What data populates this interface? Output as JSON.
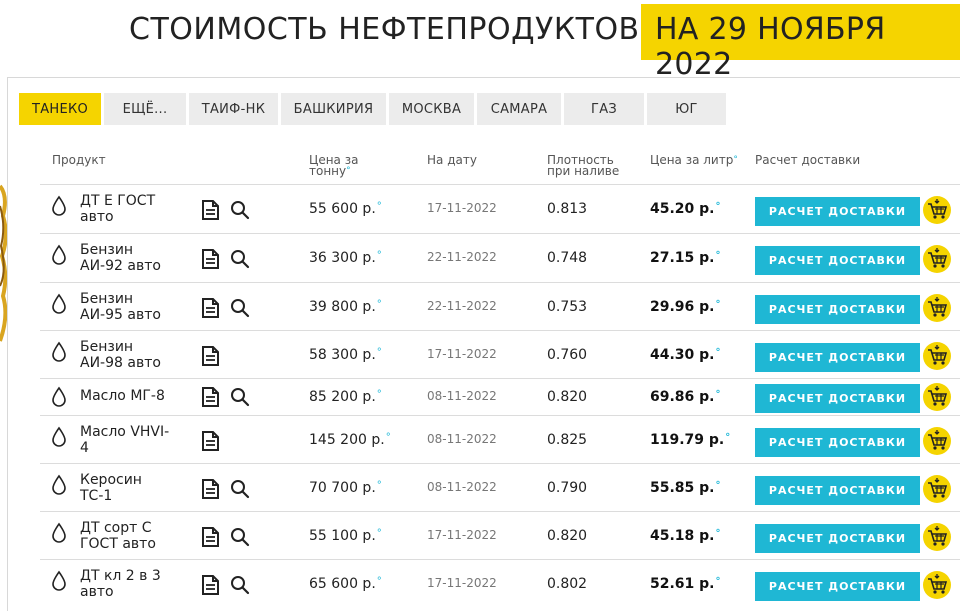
{
  "header": {
    "title": "СТОИМОСТЬ НЕФТЕПРОДУКТОВ",
    "date": "НА 29 НОЯБРЯ 2022"
  },
  "tabs": [
    {
      "label": "ТАНЕКО",
      "active": true
    },
    {
      "label": "ЕЩЁ...",
      "active": false
    },
    {
      "label": "ТАИФ-НК",
      "active": false
    },
    {
      "label": "БАШКИРИЯ",
      "active": false
    },
    {
      "label": "МОСКВА",
      "active": false
    },
    {
      "label": "САМАРА",
      "active": false
    },
    {
      "label": "ГАЗ",
      "active": false
    },
    {
      "label": "ЮГ",
      "active": false
    }
  ],
  "columns": {
    "product": "Продукт",
    "price_ton_1": "Цена за",
    "price_ton_2": "тонну",
    "date": "На дату",
    "density_1": "Плотность",
    "density_2": "при наливе",
    "price_liter": "Цена за литр",
    "delivery": "Расчет доставки"
  },
  "marker": "°",
  "delivery_button": "РАСЧЕТ ДОСТАВКИ",
  "colors": {
    "accent": "#f5d400",
    "button": "#1fb7d4",
    "marker": "#18b5d6"
  },
  "rows": [
    {
      "name_1": "ДТ Е ГОСТ",
      "name_2": "авто",
      "has_search": true,
      "price_ton": "55 600 р.",
      "date": "17-11-2022",
      "density": "0.813",
      "price_liter": "45.20 р."
    },
    {
      "name_1": "Бензин",
      "name_2": "АИ-92 авто",
      "has_search": true,
      "price_ton": "36 300 р.",
      "date": "22-11-2022",
      "density": "0.748",
      "price_liter": "27.15 р."
    },
    {
      "name_1": "Бензин",
      "name_2": "АИ-95 авто",
      "has_search": true,
      "price_ton": "39 800 р.",
      "date": "22-11-2022",
      "density": "0.753",
      "price_liter": "29.96 р."
    },
    {
      "name_1": "Бензин",
      "name_2": "АИ-98 авто",
      "has_search": false,
      "price_ton": "58 300 р.",
      "date": "17-11-2022",
      "density": "0.760",
      "price_liter": "44.30 р."
    },
    {
      "name_1": "Масло МГ-8",
      "name_2": "",
      "has_search": true,
      "price_ton": "85 200 р.",
      "date": "08-11-2022",
      "density": "0.820",
      "price_liter": "69.86 р."
    },
    {
      "name_1": "Масло VHVI-",
      "name_2": "4",
      "has_search": false,
      "price_ton": "145 200 р.",
      "date": "08-11-2022",
      "density": "0.825",
      "price_liter": "119.79 р."
    },
    {
      "name_1": "Керосин",
      "name_2": "ТС-1",
      "has_search": true,
      "price_ton": "70 700 р.",
      "date": "08-11-2022",
      "density": "0.790",
      "price_liter": "55.85 р."
    },
    {
      "name_1": "ДТ сорт С",
      "name_2": "ГОСТ авто",
      "has_search": true,
      "price_ton": "55 100 р.",
      "date": "17-11-2022",
      "density": "0.820",
      "price_liter": "45.18 р."
    },
    {
      "name_1": "ДТ кл 2 в 3",
      "name_2": "авто",
      "has_search": true,
      "price_ton": "65 600 р.",
      "date": "17-11-2022",
      "density": "0.802",
      "price_liter": "52.61 р."
    }
  ]
}
